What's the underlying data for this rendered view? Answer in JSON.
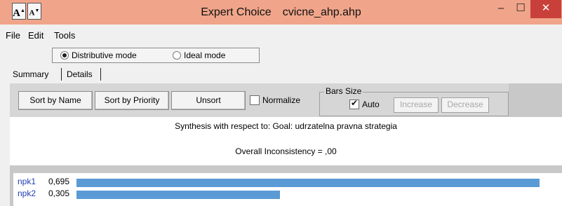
{
  "window": {
    "app_name": "Expert Choice",
    "file_name": "cvicne_ahp.ahp",
    "minimize_glyph": "–",
    "maximize_glyph": "☐",
    "close_glyph": "✕"
  },
  "menu": [
    "File",
    "Edit",
    "Tools"
  ],
  "toolbar": {
    "font_increase": "A",
    "font_decrease": "A",
    "modes": [
      {
        "label": "Distributive mode",
        "selected": true
      },
      {
        "label": "Ideal mode",
        "selected": false
      }
    ]
  },
  "tabs": [
    {
      "label": "Summary",
      "active": true
    },
    {
      "label": "Details",
      "active": false
    }
  ],
  "controls": {
    "sort_by_name": "Sort by Name",
    "sort_by_priority": "Sort by Priority",
    "unsort": "Unsort",
    "normalize": {
      "label": "Normalize",
      "checked": false
    },
    "bars_size": {
      "legend": "Bars Size",
      "auto": {
        "label": "Auto",
        "checked": true
      },
      "increase": "Increase",
      "decrease": "Decrease"
    }
  },
  "synthesis": {
    "title": "Synthesis with respect to: Goal: udrzatelna pravna strategia",
    "inconsistency": "Overall Inconsistency = ,00"
  },
  "results": [
    {
      "name": "npk1",
      "value": "0,695",
      "priority": 0.695
    },
    {
      "name": "npk2",
      "value": "0,305",
      "priority": 0.305
    }
  ],
  "colors": {
    "titlebar": "#f0a58a",
    "close_button": "#c9403a",
    "bar": "#5b9bd5",
    "alt_name": "#1f3fb3"
  }
}
